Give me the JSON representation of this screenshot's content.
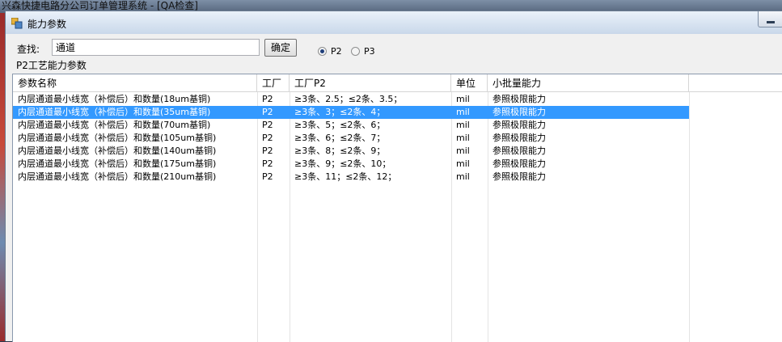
{
  "background": {
    "title": "兴森快捷电路分公司订单管理系统 - [QA检查]"
  },
  "dialog": {
    "title": "能力参数"
  },
  "search": {
    "label": "查找:",
    "value": "通道",
    "button": "确定"
  },
  "radios": [
    {
      "label": "P2",
      "checked": true
    },
    {
      "label": "P3",
      "checked": false
    }
  ],
  "group": {
    "caption": "P2工艺能力参数"
  },
  "table": {
    "columns": [
      "参数名称",
      "工厂",
      "工厂P2",
      "单位",
      "小批量能力"
    ],
    "selected_index": 1,
    "rows": [
      [
        "内层通道最小线宽（补偿后）和数量(18um基铜)",
        "P2",
        "≥3条、2.5；≤2条、3.5；",
        "mil",
        "参照极限能力"
      ],
      [
        "内层通道最小线宽（补偿后）和数量(35um基铜)",
        "P2",
        "≥3条、3；≤2条、4；",
        "mil",
        "参照极限能力"
      ],
      [
        "内层通道最小线宽（补偿后）和数量(70um基铜)",
        "P2",
        "≥3条、5；≤2条、6；",
        "mil",
        "参照极限能力"
      ],
      [
        "内层通道最小线宽（补偿后）和数量(105um基铜)",
        "P2",
        "≥3条、6；≤2条、7；",
        "mil",
        "参照极限能力"
      ],
      [
        "内层通道最小线宽（补偿后）和数量(140um基铜)",
        "P2",
        "≥3条、8；≤2条、9；",
        "mil",
        "参照极限能力"
      ],
      [
        "内层通道最小线宽（补偿后）和数量(175um基铜)",
        "P2",
        "≥3条、9；≤2条、10；",
        "mil",
        "参照极限能力"
      ],
      [
        "内层通道最小线宽（补偿后）和数量(210um基铜)",
        "P2",
        "≥3条、11；≤2条、12；",
        "mil",
        "参照极限能力"
      ]
    ]
  },
  "colors": {
    "selection": "#3399ff",
    "dialog_bg": "#f0f0f0"
  }
}
